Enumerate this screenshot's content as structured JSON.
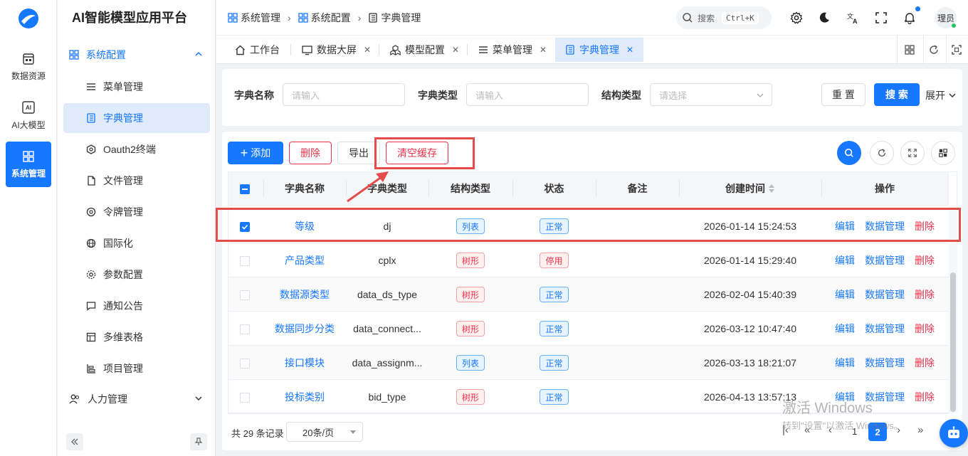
{
  "rail": {
    "items": [
      {
        "label": "数据资源",
        "icon": "database-icon"
      },
      {
        "label": "AI大模型",
        "icon": "ai-icon"
      },
      {
        "label": "系统管理",
        "icon": "grid-icon"
      }
    ]
  },
  "sidebar": {
    "title": "AI智能模型应用平台",
    "group": "系统配置",
    "items": [
      {
        "label": "菜单管理",
        "icon": "menu-list-icon"
      },
      {
        "label": "字典管理",
        "icon": "dictionary-icon"
      },
      {
        "label": "Oauth2终端",
        "icon": "hexagon-icon"
      },
      {
        "label": "文件管理",
        "icon": "file-icon"
      },
      {
        "label": "令牌管理",
        "icon": "token-icon"
      },
      {
        "label": "国际化",
        "icon": "globe-icon"
      },
      {
        "label": "参数配置",
        "icon": "settings-icon"
      },
      {
        "label": "通知公告",
        "icon": "message-icon"
      },
      {
        "label": "多维表格",
        "icon": "table-icon"
      },
      {
        "label": "项目管理",
        "icon": "project-icon"
      }
    ],
    "group2": "人力管理"
  },
  "breadcrumb": [
    "系统管理",
    "系统配置",
    "字典管理"
  ],
  "header": {
    "search_label": "搜索",
    "shortcut": "Ctrl+K",
    "avatar_text": "理员"
  },
  "tabs": [
    {
      "label": "工作台"
    },
    {
      "label": "数据大屏"
    },
    {
      "label": "模型配置"
    },
    {
      "label": "菜单管理"
    },
    {
      "label": "字典管理"
    }
  ],
  "filters": {
    "name_label": "字典名称",
    "name_placeholder": "请输入",
    "type_label": "字典类型",
    "type_placeholder": "请输入",
    "struct_label": "结构类型",
    "struct_placeholder": "请选择",
    "reset": "重 置",
    "search": "搜 索",
    "expand": "展开"
  },
  "toolbar": {
    "add": "添加",
    "delete": "删除",
    "export": "导出",
    "clear_cache": "清空缓存"
  },
  "table": {
    "headers": [
      "字典名称",
      "字典类型",
      "结构类型",
      "状态",
      "备注",
      "创建时间",
      "操作"
    ],
    "rows": [
      {
        "name": "等级",
        "type": "dj",
        "struct": "列表",
        "status": "正常",
        "remark": "",
        "created": "2026-01-14 15:24:53"
      },
      {
        "name": "产品类型",
        "type": "cplx",
        "struct": "树形",
        "status": "停用",
        "remark": "",
        "created": "2026-01-14 15:29:40"
      },
      {
        "name": "数据源类型",
        "type": "data_ds_type",
        "struct": "树形",
        "status": "正常",
        "remark": "",
        "created": "2026-02-04 15:40:39"
      },
      {
        "name": "数据同步分类",
        "type": "data_connect...",
        "struct": "树形",
        "status": "正常",
        "remark": "",
        "created": "2026-03-12 10:47:40"
      },
      {
        "name": "接口模块",
        "type": "data_assignm...",
        "struct": "列表",
        "status": "正常",
        "remark": "",
        "created": "2026-03-13 18:21:07"
      },
      {
        "name": "投标类别",
        "type": "bid_type",
        "struct": "树形",
        "status": "正常",
        "remark": "",
        "created": "2026-04-13 13:57:13"
      }
    ],
    "actions": {
      "edit": "编辑",
      "data": "数据管理",
      "del": "删除"
    }
  },
  "pagination": {
    "total": "共 29 条记录",
    "page_size": "20条/页",
    "pages": [
      "1",
      "2"
    ]
  },
  "watermark": {
    "line1": "激活 Windows",
    "line2": "转到\"设置\"以激活 Windows。"
  },
  "colors": {
    "accent": "#1677ff",
    "danger": "#e8334c",
    "annotation": "#e44b4b"
  }
}
